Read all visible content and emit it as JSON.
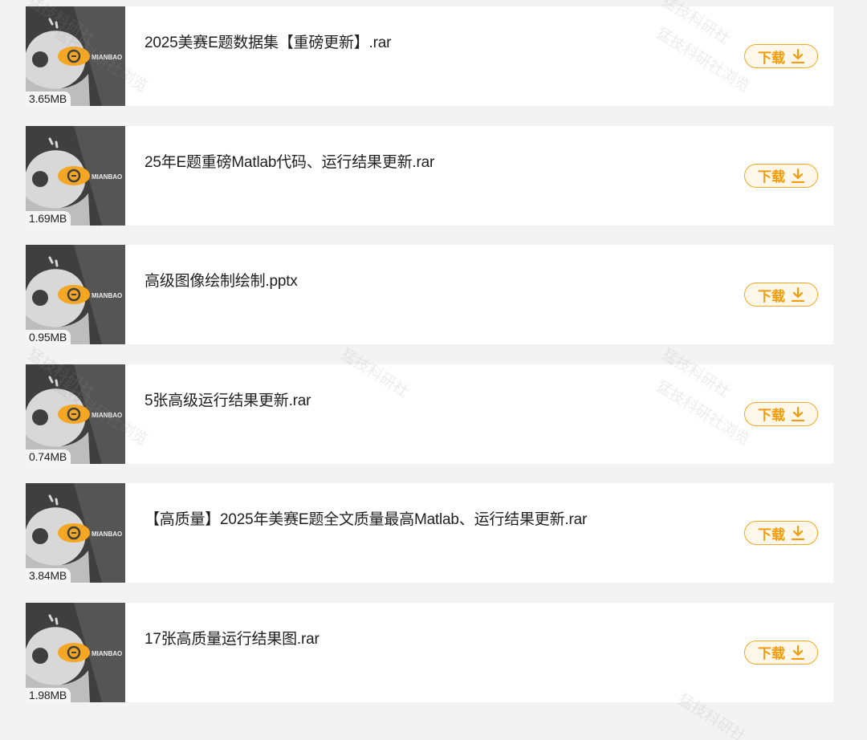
{
  "download_label": "下载",
  "thumb_brand": "MIANBAO",
  "files": [
    {
      "name": "2025美赛E题数据集【重磅更新】.rar",
      "size": "3.65MB"
    },
    {
      "name": "25年E题重磅Matlab代码、运行结果更新.rar",
      "size": "1.69MB"
    },
    {
      "name": "高级图像绘制绘制.pptx",
      "size": "0.95MB"
    },
    {
      "name": "5张高级运行结果更新.rar",
      "size": "0.74MB"
    },
    {
      "name": "【高质量】2025年美赛E题全文质量最高Matlab、运行结果更新.rar",
      "size": "3.84MB"
    },
    {
      "name": "17张高质量运行结果图.rar",
      "size": "1.98MB"
    }
  ],
  "watermark": "猛技科研社",
  "watermark_sub": "猛技科研社浏览",
  "colors": {
    "accent": "#f5a623",
    "thumb_bg": "#3f3f3f",
    "page_bg": "#f3f3f3"
  }
}
